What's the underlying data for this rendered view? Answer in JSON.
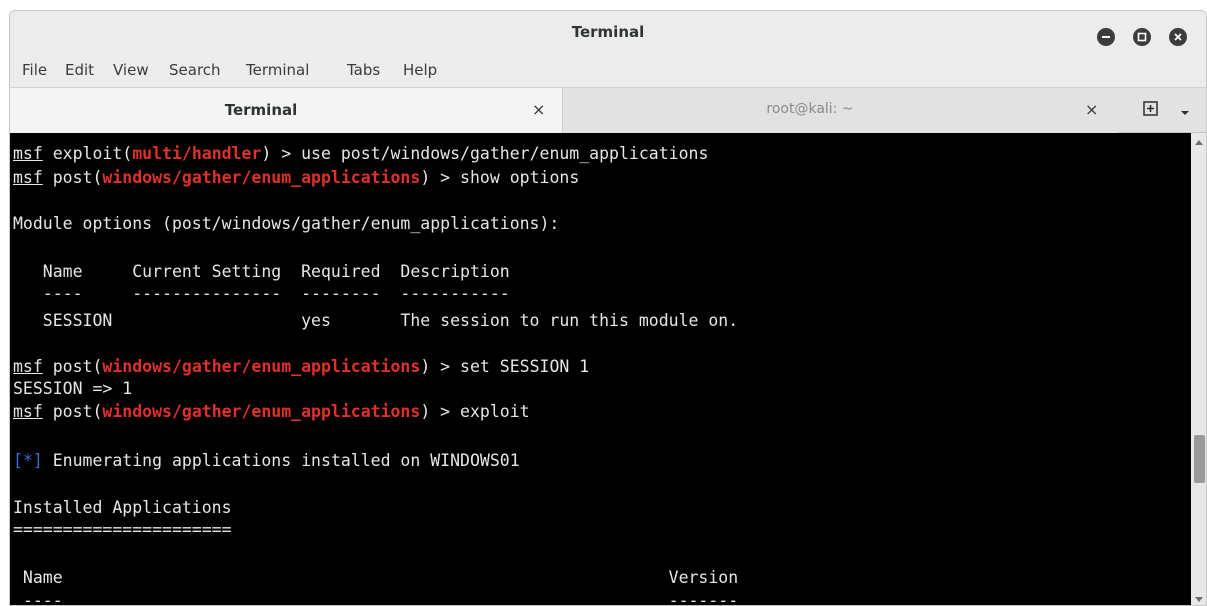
{
  "window": {
    "title": "Terminal"
  },
  "menubar": {
    "items": [
      "File",
      "Edit",
      "View",
      "Search",
      "Terminal",
      "Tabs",
      "Help"
    ]
  },
  "tabs": [
    {
      "label": "Terminal",
      "close": "×",
      "active": true
    },
    {
      "label": "root@kali: ~",
      "close": "×",
      "active": false
    }
  ],
  "terminal": {
    "l1_prompt": "msf",
    "l1_a": " exploit(",
    "l1_mod": "multi/handler",
    "l1_b": ") > use post/windows/gather/enum_applications",
    "l2_prompt": "msf",
    "l2_a": " post(",
    "l2_mod": "windows/gather/enum_applications",
    "l2_b": ") > show options",
    "l3": "Module options (post/windows/gather/enum_applications):",
    "l4": "   Name     Current Setting  Required  Description",
    "l5": "   ----     ---------------  --------  -----------",
    "l6": "   SESSION                   yes       The session to run this module on.",
    "l7_prompt": "msf",
    "l7_a": " post(",
    "l7_mod": "windows/gather/enum_applications",
    "l7_b": ") > set SESSION 1",
    "l8": "SESSION => 1",
    "l9_prompt": "msf",
    "l9_a": " post(",
    "l9_mod": "windows/gather/enum_applications",
    "l9_b": ") > exploit",
    "l10_tag": "[*]",
    "l10_b": " Enumerating applications installed on WINDOWS01",
    "l11": "Installed Applications",
    "l12": "======================",
    "l13": " Name                                                             Version",
    "l14": " ----                                                             -------"
  },
  "colors": {
    "terminal_bg": "#000000",
    "module_red": "#e0302c",
    "info_blue": "#3a6cd0",
    "text": "#e6e6e6"
  }
}
